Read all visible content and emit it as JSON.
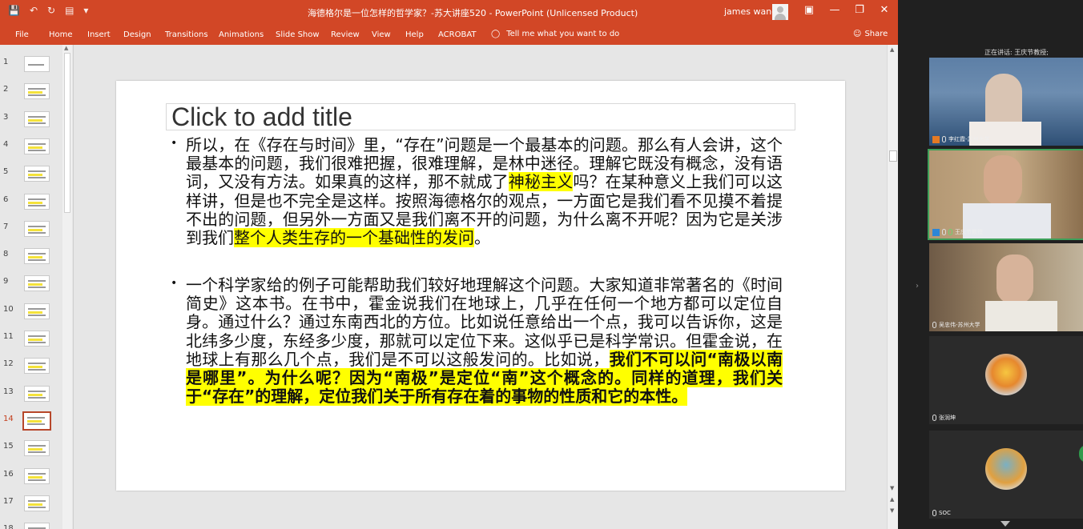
{
  "app": {
    "window_title": "海德格尔是一位怎样的哲学家？-苏大讲座520  -  PowerPoint (Unlicensed Product)",
    "user_name": "james wang",
    "qat_icons": [
      "save-icon",
      "undo-icon",
      "redo-icon",
      "present-icon",
      "customize-icon"
    ]
  },
  "ribbon": {
    "tabs": [
      "File",
      "Home",
      "Insert",
      "Design",
      "Transitions",
      "Animations",
      "Slide Show",
      "Review",
      "View",
      "Help",
      "ACROBAT"
    ],
    "tell_me": "Tell me what you want to do",
    "share": "Share"
  },
  "thumbnails": {
    "numbers": [
      "1",
      "2",
      "3",
      "4",
      "5",
      "6",
      "7",
      "8",
      "9",
      "10",
      "11",
      "12",
      "13",
      "14",
      "15",
      "16",
      "17",
      "18"
    ],
    "active_index": 13
  },
  "slide": {
    "title_placeholder": "Click to add title",
    "bullet1": {
      "t1": "所以，在《存在与时间》里，“存在”问题是一个最基本的问题。那么有人会讲，这个最基本的问题，我们很难把握，很难理解，是林中迷径。理解它既没有概念，没有语词，又没有方法。如果真的这样，那不就成了",
      "h1": "神秘主义",
      "t2": "吗？在某种意义上我们可以这样讲，但是也不完全是这样。按照海德格尔的观点，一方面它是我们看不见摸不着提不出的问题，但另外一方面又是我们离不开的问题，为什么离不开呢？因为它是关涉到我们",
      "h2": "整个人类生存的一个基础性的发问",
      "t3": "。"
    },
    "bullet2": {
      "t1": "一个科学家给的例子可能帮助我们较好地理解这个问题。大家知道非常著名的《时间简史》这本书。在书中，霍金说我们在地球上，几乎在任何一个地方都可以定位自身。通过什么？通过东南西北的方位。比如说任意给出一个点，我可以告诉你，这是北纬多少度，东经多少度，那就可以定位下来。这似乎已是科学常识。但霍金说，在地球上有那么几个点，我们是不可以这般发问的。比如说，",
      "h1": "我们不可以问“南极以南是哪里”。为什么呢？因为“南极”是定位“南”这个概念的。同样的道理，我们关于“存在”的理解，定位我们关于所有存在着的事物的性质和它的本性。"
    },
    "bullet_char": "•"
  },
  "meeting": {
    "speaking_label": "正在讲话: 王庆节教授;",
    "participants": [
      {
        "name": "李红霞-苏州大学"
      },
      {
        "name": "王庆节教授"
      },
      {
        "name": "吴忠伟-苏州大学"
      },
      {
        "name": "张润坤"
      },
      {
        "name": "SOC"
      }
    ]
  },
  "colors": {
    "accent": "#d24726",
    "highlight": "#ffff00",
    "active_speaker": "#3ea05a"
  }
}
